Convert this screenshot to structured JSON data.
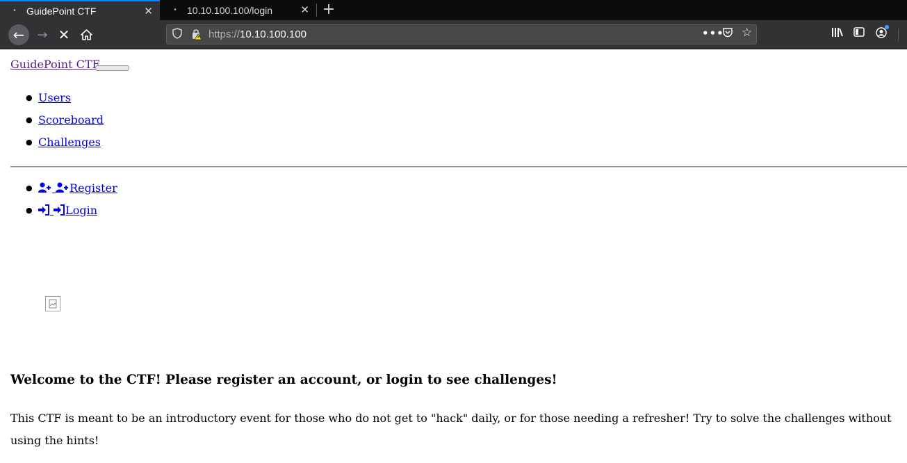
{
  "browser": {
    "tabs": [
      {
        "title": "GuidePoint CTF",
        "active": true
      },
      {
        "title": "10.10.100.100/login",
        "active": false
      }
    ],
    "url": {
      "scheme": "https://",
      "host": "10.10.100.100"
    },
    "icons": [
      "back-icon",
      "forward-icon",
      "stop-icon",
      "home-icon",
      "shield-icon",
      "insecure-lock-icon",
      "page-actions-icon",
      "pocket-icon",
      "bookmark-star-icon",
      "library-icon",
      "sidebar-icon",
      "account-icon",
      "overflow-icon"
    ],
    "colors": {
      "tabbar": "#0c0c0d",
      "toolbar": "#323234",
      "urlbar": "#474749",
      "accent": "#0a84ff"
    }
  },
  "page": {
    "brand": "GuidePoint CTF",
    "nav": [
      {
        "label": "Users"
      },
      {
        "label": "Scoreboard"
      },
      {
        "label": "Challenges"
      }
    ],
    "account_nav": [
      {
        "label": "Register",
        "icon": "user-plus-icon"
      },
      {
        "label": "Login",
        "icon": "sign-in-icon"
      }
    ],
    "welcome": "Welcome to the CTF! Please register an account, or login to see challenges!",
    "intro": "This CTF is meant to be an introductory event for those who do not get to \"hack\" daily, or for those needing a refresher! Try to solve the challenges without using the hints!",
    "colors": {
      "link": "#0000ee",
      "visited": "#551a8b"
    }
  }
}
